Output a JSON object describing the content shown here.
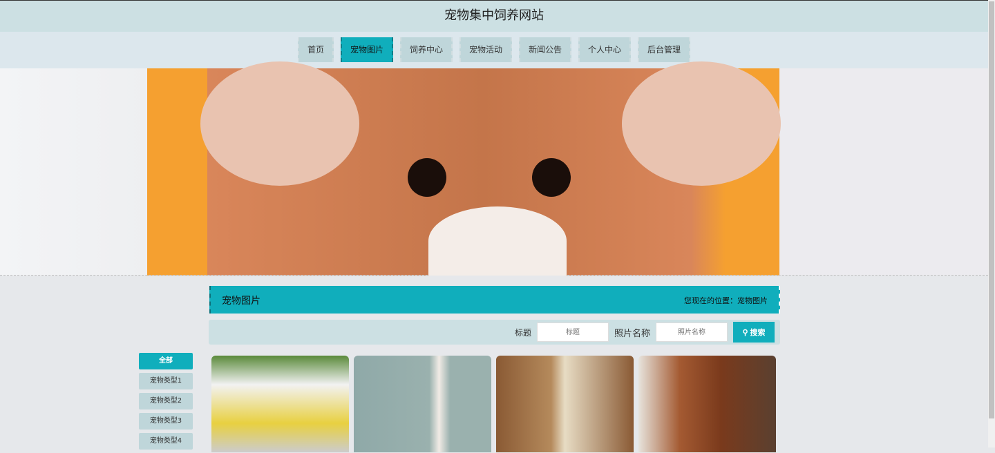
{
  "header": {
    "title": "宠物集中饲养网站"
  },
  "nav": {
    "items": [
      {
        "label": "首页"
      },
      {
        "label": "宠物图片",
        "active": true
      },
      {
        "label": "饲养中心"
      },
      {
        "label": "宠物活动"
      },
      {
        "label": "新闻公告"
      },
      {
        "label": "个人中心"
      },
      {
        "label": "后台管理"
      }
    ]
  },
  "breadcrumb": {
    "title": "宠物图片",
    "position": "您现在的位置：宠物图片"
  },
  "search": {
    "title_label": "标题",
    "title_placeholder": "标题",
    "name_label": "照片名称",
    "name_placeholder": "照片名称",
    "button": "搜索"
  },
  "sidebar": {
    "items": [
      {
        "label": "全部",
        "active": true
      },
      {
        "label": "宠物类型1"
      },
      {
        "label": "宠物类型2"
      },
      {
        "label": "宠物类型3"
      },
      {
        "label": "宠物类型4"
      }
    ]
  },
  "colors": {
    "accent": "#10aebc",
    "header_bg": "#cce0e3"
  }
}
